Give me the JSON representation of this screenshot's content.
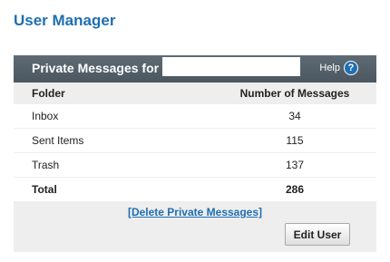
{
  "page": {
    "title": "User Manager"
  },
  "panel": {
    "title": "Private Messages for",
    "help_label": "Help",
    "help_icon_glyph": "?",
    "columns": {
      "folder": "Folder",
      "messages": "Number of Messages"
    },
    "rows": [
      {
        "folder": "Inbox",
        "count": "34"
      },
      {
        "folder": "Sent Items",
        "count": "115"
      },
      {
        "folder": "Trash",
        "count": "137"
      }
    ],
    "total": {
      "label": "Total",
      "count": "286"
    },
    "delete_link": "[Delete Private Messages]",
    "edit_button": "Edit User"
  },
  "colors": {
    "accent": "#1f6fb2",
    "header_bg": "#55616a",
    "panel_bg": "#eeeeee"
  },
  "icons": {
    "help": "help-icon"
  }
}
